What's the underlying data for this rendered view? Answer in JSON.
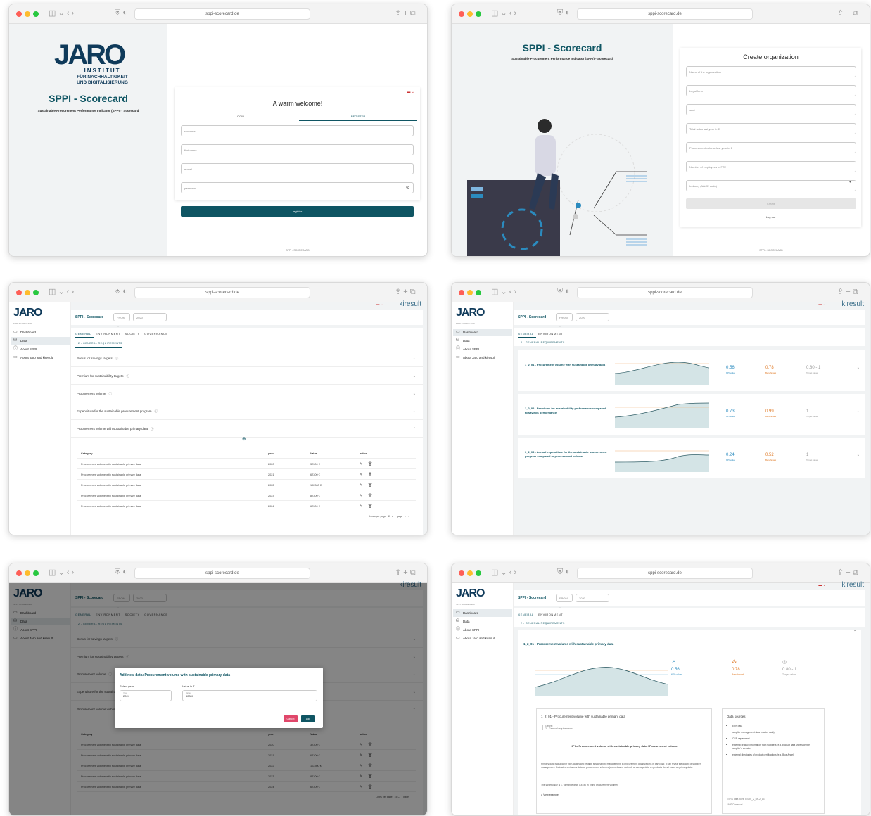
{
  "url": "sppi-scorecard.de",
  "brand": {
    "logo": "JARO",
    "institute_line1": "INSTITUT",
    "institute_line2": "FÜR NACHHALTIGKEIT",
    "institute_line3": "UND DIGITALISIERUNG",
    "app_title": "SPPI - Scorecard",
    "subtitle": "Sustainable Procurement Performance Indicator (SPPI) - Scorecard",
    "footer": "SPPI - SCORECARD",
    "partner": "kiresult"
  },
  "login": {
    "welcome": "A warm welcome!",
    "tab_login": "LOGIN",
    "tab_register": "REGISTER",
    "surname": "surname",
    "firstname": "first name",
    "email": "e-mail",
    "password": "password",
    "register_btn": "register"
  },
  "create_org": {
    "title": "Create organization",
    "fields": [
      "Name of the organization",
      "Legal form",
      "seat",
      "Total sales last year in €",
      "Procurement volume last year in €",
      "Number of employees in FTE",
      "Industry (NACE code)"
    ],
    "create_btn": "Create",
    "logout": "Log out"
  },
  "app": {
    "breadcrumb": "SPPI - Scorecard",
    "period_label": "Period",
    "from": "FROM ...",
    "year": "2020",
    "nav_section": "SPPI SCORECARD",
    "nav": [
      "Dashboard",
      "Data",
      "About SPPI",
      "About Jaro and kiresult"
    ],
    "tabs": [
      "GENERAL",
      "ENVIRONMENT",
      "SOCIETY",
      "GOVERNANCE"
    ],
    "subtab": "2 - GENERAL REQUIREMENTS",
    "accordions": [
      "Bonus for savings targets",
      "Premium for sustainability targets",
      "Procurement volume",
      "Expenditure for the sustainable procurement program",
      "Procurement volume with sustainable primary data"
    ],
    "table": {
      "headers": [
        "Category",
        "year",
        "Value",
        "action"
      ],
      "rows": [
        [
          "Procurement volume with sustainable primary data",
          "2020",
          "32300 €"
        ],
        [
          "Procurement volume with sustainable primary data",
          "2021",
          "62300 €"
        ],
        [
          "Procurement volume with sustainable primary data",
          "2022",
          "102300 €"
        ],
        [
          "Procurement volume with sustainable primary data",
          "2023",
          "82300 €"
        ],
        [
          "Procurement volume with sustainable primary data",
          "2024",
          "62300 €"
        ]
      ],
      "lines_per_page": "Lines per page",
      "per_page": "15",
      "page": "page"
    }
  },
  "kpis": [
    {
      "title": "1_2_01 - Procurement volume with sustainable primary data",
      "kpi": "0.56",
      "bench": "0.78",
      "target": "0.80 - 1"
    },
    {
      "title": "2_2_02 - Premiums for sustainability performance compared to savings performance",
      "kpi": "0.73",
      "bench": "0.99",
      "target": "1"
    },
    {
      "title": "3_2_03 - Annual expenditure for the sustainable procurement program compared to procurement volume",
      "kpi": "0.24",
      "bench": "0.52",
      "target": "1"
    }
  ],
  "kpi_labels": {
    "kpi": "KPI value",
    "bench": "Benchmark",
    "target": "Target value"
  },
  "dialog": {
    "title": "Add new data: Procurement volume with sustainable primary data",
    "select_year": "Select year",
    "year_small": "Year",
    "year_value": "2024",
    "value_label": "Value in €",
    "value_small": "Value",
    "value_value": "62300",
    "cancel": "Cancel",
    "add": "Add"
  },
  "detail": {
    "title": "1_2_01 - Procurement volume with sustainable primary data",
    "card_title": "1_2_01 - Procurement volume with sustainable primary data",
    "genre": "Genre:",
    "genre_value": "2 - General requirements",
    "formula": "KPI = Procurement volume with sustainable primary data / Procurement volume",
    "text": "Primary data is crucial for high-quality and reliable sustainability management. In procurement organizations in particular, it can reveal the quality of supplier management. Estimated emissions data on procurement volumes (spend-based method) or average data on products do not count as primary data.",
    "target_text": "The target value is 1. tolerance limit: 0.8 (80 % of the procurement volume)",
    "example": "View example",
    "sources_title": "Data sources",
    "sources": [
      "ERP data",
      "supplier management data (master data)",
      "CSR department",
      "external product information from suppliers (e.g. product data sheets on the supplier's website)",
      "external directories of product certifications (e.g. Blue Angel)"
    ],
    "esrs": "ESRS data point: ESRS_2_BP-2_13",
    "unido": "UNIDO manual -"
  },
  "colors": {
    "accent": "#0f5563",
    "kpi": "#2b8bbf",
    "bench": "#e07b28",
    "target": "#999999",
    "cancel": "#e0476a"
  }
}
